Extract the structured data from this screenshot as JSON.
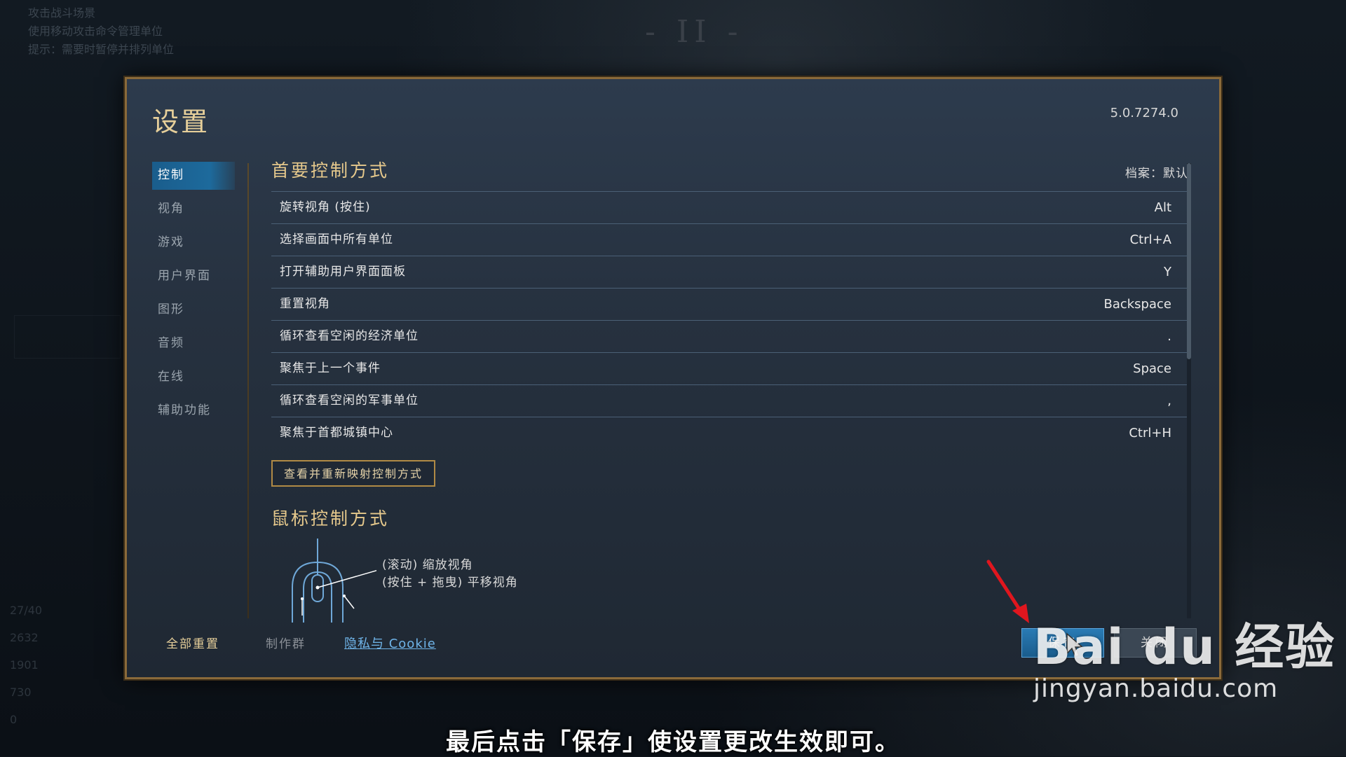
{
  "background": {
    "hud_lines": [
      "攻击战斗场景",
      "使用移动攻击命令管理单位",
      "提示：需要时暂停并排列单位"
    ],
    "pause_glyph": "- II -",
    "stats": [
      "27/40",
      "2632",
      "1901",
      "730",
      "0"
    ]
  },
  "modal": {
    "title": "设置",
    "version": "5.0.7274.0"
  },
  "sidebar": {
    "items": [
      {
        "label": "控制",
        "active": true
      },
      {
        "label": "视角",
        "active": false
      },
      {
        "label": "游戏",
        "active": false
      },
      {
        "label": "用户界面",
        "active": false
      },
      {
        "label": "图形",
        "active": false
      },
      {
        "label": "音频",
        "active": false
      },
      {
        "label": "在线",
        "active": false
      },
      {
        "label": "辅助功能",
        "active": false
      }
    ]
  },
  "controls": {
    "section_title": "首要控制方式",
    "profile_label": "档案：默认",
    "rows": [
      {
        "action": "旋转视角 (按住)",
        "key": "Alt"
      },
      {
        "action": "选择画面中所有单位",
        "key": "Ctrl+A"
      },
      {
        "action": "打开辅助用户界面面板",
        "key": "Y"
      },
      {
        "action": "重置视角",
        "key": "Backspace"
      },
      {
        "action": "循环查看空闲的经济单位",
        "key": "."
      },
      {
        "action": "聚焦于上一个事件",
        "key": "Space"
      },
      {
        "action": "循环查看空闲的军事单位",
        "key": ","
      },
      {
        "action": "聚焦于首都城镇中心",
        "key": "Ctrl+H"
      }
    ],
    "remap_button": "查看并重新映射控制方式"
  },
  "mouse": {
    "section_title": "鼠标控制方式",
    "line1": "(滚动) 缩放视角",
    "line2": "(按住 + 拖曳) 平移视角"
  },
  "footer": {
    "reset_all": "全部重置",
    "credits": "制作群",
    "privacy": "隐私与 Cookie",
    "save": "保存",
    "close": "关闭"
  },
  "watermark": {
    "logo_text": "Bai du 经验",
    "url": "jingyan.baidu.com"
  },
  "caption": "最后点击「保存」使设置更改生效即可。",
  "colors": {
    "accent_gold": "#e6c98c",
    "active_blue": "#1d6a9c",
    "link_blue": "#6fb4e8",
    "arrow_red": "#e0161e"
  }
}
